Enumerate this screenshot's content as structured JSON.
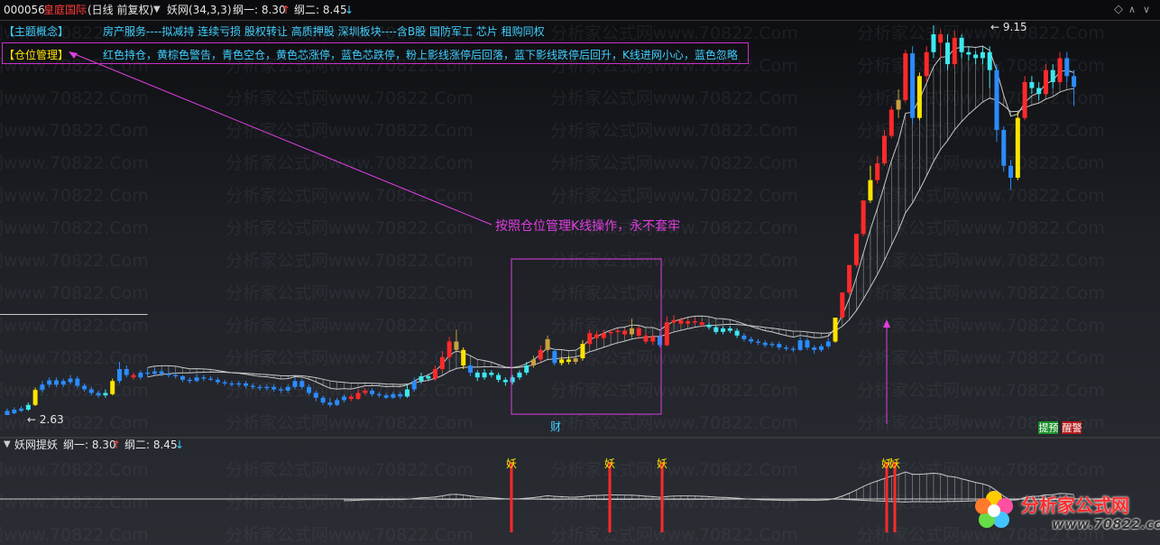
{
  "header": {
    "stock_code": "000056",
    "stock_name": "皇庭国际",
    "period": "(日线 前复权)",
    "indicator": "妖网(34,3,3)",
    "line1_label": "纲一: 8.30",
    "line1_arrow": "↑",
    "line2_label": "纲二: 8.45",
    "line2_arrow": "↓"
  },
  "info": {
    "theme_label": "【主题概念】",
    "theme_text": "房产服务----拟减持 连续亏损 股权转让 高质押股 深圳板块----含B股 国防军工 芯片 租购同权",
    "position_label": "【仓位管理】",
    "position_text": "红色持仓，黄棕色警告，青色空仓，黄色芯涨停，蓝色芯跌停，粉上影线涨停后回落，蓝下影线跌停后回升，K线进网小心，蓝色忽略"
  },
  "annotations": {
    "arrow_note": "按照仓位管理K线操作，永不套牢",
    "low_label": "2.63",
    "high_label": "9.15",
    "box_tag": "财",
    "tag_yu": "预",
    "tag_jing": "警",
    "tag_ti": "提",
    "tag_xing": "醒"
  },
  "sub_header": {
    "indicator": "妖网提妖",
    "line1_label": "纲一: 8.30",
    "line1_arrow": "↑",
    "line2_label": "纲二: 8.45",
    "line2_arrow": "↓"
  },
  "signal_char": "妖",
  "watermark": "分析家公式网www.70822.Com",
  "logo": {
    "name": "分析家公式网",
    "url": "www.70822.com"
  },
  "colors": {
    "red": "#ff2a2a",
    "yellow": "#ffe400",
    "brown": "#c8a040",
    "cyan": "#3de8f0",
    "blue": "#2a8cff",
    "white": "#ffffff",
    "band": "#c8c8c8",
    "magenta": "#e03ee0"
  },
  "chart_data": {
    "type": "candlestick",
    "y_range_approx": [
      2.4,
      9.3
    ],
    "candles": [
      {
        "o": 2.63,
        "c": 2.7,
        "h": 2.74,
        "l": 2.63,
        "col": "blue"
      },
      {
        "o": 2.66,
        "c": 2.72,
        "h": 2.76,
        "l": 2.64,
        "col": "blue"
      },
      {
        "o": 2.7,
        "c": 2.74,
        "h": 2.78,
        "l": 2.68,
        "col": "blue"
      },
      {
        "o": 2.72,
        "c": 2.8,
        "h": 2.84,
        "l": 2.7,
        "col": "cyan"
      },
      {
        "o": 2.8,
        "c": 3.05,
        "h": 3.09,
        "l": 2.78,
        "col": "yellow"
      },
      {
        "o": 3.05,
        "c": 3.14,
        "h": 3.2,
        "l": 3.01,
        "col": "blue"
      },
      {
        "o": 3.14,
        "c": 3.21,
        "h": 3.26,
        "l": 3.09,
        "col": "blue"
      },
      {
        "o": 3.21,
        "c": 3.14,
        "h": 3.26,
        "l": 3.1,
        "col": "blue"
      },
      {
        "o": 3.14,
        "c": 3.2,
        "h": 3.24,
        "l": 3.1,
        "col": "blue"
      },
      {
        "o": 3.18,
        "c": 3.24,
        "h": 3.3,
        "l": 3.14,
        "col": "blue"
      },
      {
        "o": 3.24,
        "c": 3.12,
        "h": 3.28,
        "l": 3.08,
        "col": "blue"
      },
      {
        "o": 3.12,
        "c": 3.06,
        "h": 3.16,
        "l": 3.02,
        "col": "blue"
      },
      {
        "o": 3.06,
        "c": 3.0,
        "h": 3.1,
        "l": 2.96,
        "col": "blue"
      },
      {
        "o": 3.0,
        "c": 2.96,
        "h": 3.04,
        "l": 2.92,
        "col": "blue"
      },
      {
        "o": 2.96,
        "c": 3.0,
        "h": 3.06,
        "l": 2.92,
        "col": "cyan"
      },
      {
        "o": 2.98,
        "c": 3.2,
        "h": 3.24,
        "l": 2.96,
        "col": "yellow"
      },
      {
        "o": 3.2,
        "c": 3.4,
        "h": 3.52,
        "l": 3.16,
        "col": "blue"
      },
      {
        "o": 3.4,
        "c": 3.3,
        "h": 3.46,
        "l": 3.26,
        "col": "blue"
      },
      {
        "o": 3.3,
        "c": 3.26,
        "h": 3.34,
        "l": 3.22,
        "col": "red"
      },
      {
        "o": 3.26,
        "c": 3.34,
        "h": 3.38,
        "l": 3.22,
        "col": "blue"
      },
      {
        "o": 3.34,
        "c": 3.32,
        "h": 3.4,
        "l": 3.28,
        "col": "blue"
      },
      {
        "o": 3.32,
        "c": 3.36,
        "h": 3.42,
        "l": 3.28,
        "col": "blue"
      },
      {
        "o": 3.36,
        "c": 3.32,
        "h": 3.4,
        "l": 3.28,
        "col": "blue"
      },
      {
        "o": 3.32,
        "c": 3.3,
        "h": 3.36,
        "l": 3.26,
        "col": "blue"
      },
      {
        "o": 3.3,
        "c": 3.28,
        "h": 3.34,
        "l": 3.24,
        "col": "blue"
      },
      {
        "o": 3.28,
        "c": 3.22,
        "h": 3.3,
        "l": 3.18,
        "col": "blue"
      },
      {
        "o": 3.22,
        "c": 3.2,
        "h": 3.26,
        "l": 3.16,
        "col": "blue"
      },
      {
        "o": 3.2,
        "c": 3.26,
        "h": 3.32,
        "l": 3.18,
        "col": "blue"
      },
      {
        "o": 3.26,
        "c": 3.24,
        "h": 3.3,
        "l": 3.2,
        "col": "blue"
      },
      {
        "o": 3.24,
        "c": 3.22,
        "h": 3.28,
        "l": 3.2,
        "col": "blue"
      },
      {
        "o": 3.22,
        "c": 3.18,
        "h": 3.26,
        "l": 3.14,
        "col": "blue"
      },
      {
        "o": 3.18,
        "c": 3.16,
        "h": 3.22,
        "l": 3.12,
        "col": "blue"
      },
      {
        "o": 3.16,
        "c": 3.14,
        "h": 3.2,
        "l": 3.1,
        "col": "blue"
      },
      {
        "o": 3.14,
        "c": 3.16,
        "h": 3.2,
        "l": 3.1,
        "col": "blue"
      },
      {
        "o": 3.16,
        "c": 3.12,
        "h": 3.2,
        "l": 3.08,
        "col": "blue"
      },
      {
        "o": 3.12,
        "c": 3.1,
        "h": 3.16,
        "l": 3.06,
        "col": "blue"
      },
      {
        "o": 3.1,
        "c": 3.08,
        "h": 3.14,
        "l": 3.04,
        "col": "blue"
      },
      {
        "o": 3.08,
        "c": 3.1,
        "h": 3.14,
        "l": 3.04,
        "col": "blue"
      },
      {
        "o": 3.1,
        "c": 3.06,
        "h": 3.14,
        "l": 3.02,
        "col": "blue"
      },
      {
        "o": 3.06,
        "c": 3.04,
        "h": 3.1,
        "l": 3.0,
        "col": "blue"
      },
      {
        "o": 3.04,
        "c": 3.1,
        "h": 3.14,
        "l": 3.0,
        "col": "blue"
      },
      {
        "o": 3.1,
        "c": 3.2,
        "h": 3.26,
        "l": 3.06,
        "col": "blue"
      },
      {
        "o": 3.2,
        "c": 3.1,
        "h": 3.24,
        "l": 3.06,
        "col": "blue"
      },
      {
        "o": 3.1,
        "c": 3.0,
        "h": 3.14,
        "l": 2.96,
        "col": "blue"
      },
      {
        "o": 3.0,
        "c": 2.92,
        "h": 3.04,
        "l": 2.86,
        "col": "blue"
      },
      {
        "o": 2.92,
        "c": 2.84,
        "h": 2.96,
        "l": 2.8,
        "col": "blue"
      },
      {
        "o": 2.84,
        "c": 2.8,
        "h": 2.92,
        "l": 2.76,
        "col": "blue"
      },
      {
        "o": 2.8,
        "c": 2.88,
        "h": 2.92,
        "l": 2.78,
        "col": "blue"
      },
      {
        "o": 2.88,
        "c": 2.94,
        "h": 2.98,
        "l": 2.84,
        "col": "blue"
      },
      {
        "o": 2.94,
        "c": 2.9,
        "h": 2.98,
        "l": 2.86,
        "col": "red"
      },
      {
        "o": 2.9,
        "c": 3.0,
        "h": 3.06,
        "l": 2.88,
        "col": "red"
      },
      {
        "o": 3.0,
        "c": 3.04,
        "h": 3.08,
        "l": 2.96,
        "col": "red"
      },
      {
        "o": 3.04,
        "c": 2.98,
        "h": 3.08,
        "l": 2.94,
        "col": "blue"
      },
      {
        "o": 2.98,
        "c": 2.96,
        "h": 3.02,
        "l": 2.92,
        "col": "blue"
      },
      {
        "o": 2.96,
        "c": 2.92,
        "h": 3.0,
        "l": 2.9,
        "col": "blue"
      },
      {
        "o": 2.92,
        "c": 2.98,
        "h": 3.02,
        "l": 2.9,
        "col": "blue"
      },
      {
        "o": 2.98,
        "c": 2.94,
        "h": 3.02,
        "l": 2.9,
        "col": "blue"
      },
      {
        "o": 2.94,
        "c": 3.06,
        "h": 3.14,
        "l": 2.92,
        "col": "cyan"
      },
      {
        "o": 3.06,
        "c": 3.2,
        "h": 3.26,
        "l": 3.02,
        "col": "blue"
      },
      {
        "o": 3.2,
        "c": 3.28,
        "h": 3.34,
        "l": 3.16,
        "col": "cyan"
      },
      {
        "o": 3.28,
        "c": 3.24,
        "h": 3.32,
        "l": 3.2,
        "col": "cyan"
      },
      {
        "o": 3.24,
        "c": 3.4,
        "h": 3.46,
        "l": 3.2,
        "col": "red"
      },
      {
        "o": 3.4,
        "c": 3.6,
        "h": 3.7,
        "l": 3.36,
        "col": "red"
      },
      {
        "o": 3.6,
        "c": 3.86,
        "h": 3.94,
        "l": 3.56,
        "col": "red"
      },
      {
        "o": 3.86,
        "c": 3.72,
        "h": 4.06,
        "l": 3.7,
        "col": "brown"
      },
      {
        "o": 3.72,
        "c": 3.46,
        "h": 3.76,
        "l": 3.4,
        "col": "yellow"
      },
      {
        "o": 3.46,
        "c": 3.34,
        "h": 3.5,
        "l": 3.28,
        "col": "blue"
      },
      {
        "o": 3.34,
        "c": 3.26,
        "h": 3.38,
        "l": 3.2,
        "col": "cyan"
      },
      {
        "o": 3.26,
        "c": 3.34,
        "h": 3.4,
        "l": 3.22,
        "col": "cyan"
      },
      {
        "o": 3.34,
        "c": 3.3,
        "h": 3.38,
        "l": 3.26,
        "col": "cyan"
      },
      {
        "o": 3.3,
        "c": 3.22,
        "h": 3.34,
        "l": 3.18,
        "col": "cyan"
      },
      {
        "o": 3.22,
        "c": 3.18,
        "h": 3.26,
        "l": 3.12,
        "col": "cyan"
      },
      {
        "o": 3.18,
        "c": 3.26,
        "h": 3.3,
        "l": 3.14,
        "col": "cyan"
      },
      {
        "o": 3.26,
        "c": 3.34,
        "h": 3.38,
        "l": 3.22,
        "col": "cyan"
      },
      {
        "o": 3.34,
        "c": 3.46,
        "h": 3.52,
        "l": 3.3,
        "col": "cyan"
      },
      {
        "o": 3.46,
        "c": 3.56,
        "h": 3.62,
        "l": 3.42,
        "col": "brown"
      },
      {
        "o": 3.56,
        "c": 3.72,
        "h": 3.8,
        "l": 3.52,
        "col": "red"
      },
      {
        "o": 3.72,
        "c": 3.9,
        "h": 3.96,
        "l": 3.68,
        "col": "brown"
      },
      {
        "o": 3.7,
        "c": 3.5,
        "h": 3.74,
        "l": 3.46,
        "col": "blue"
      },
      {
        "o": 3.5,
        "c": 3.56,
        "h": 3.6,
        "l": 3.46,
        "col": "yellow"
      },
      {
        "o": 3.56,
        "c": 3.52,
        "h": 3.62,
        "l": 3.48,
        "col": "yellow"
      },
      {
        "o": 3.52,
        "c": 3.58,
        "h": 3.62,
        "l": 3.48,
        "col": "brown"
      },
      {
        "o": 3.58,
        "c": 3.82,
        "h": 3.88,
        "l": 3.54,
        "col": "yellow"
      },
      {
        "o": 3.82,
        "c": 4.0,
        "h": 4.06,
        "l": 3.78,
        "col": "red"
      },
      {
        "o": 3.98,
        "c": 3.92,
        "h": 4.04,
        "l": 3.88,
        "col": "red"
      },
      {
        "o": 3.92,
        "c": 4.0,
        "h": 4.06,
        "l": 3.88,
        "col": "red"
      },
      {
        "o": 4.0,
        "c": 4.02,
        "h": 4.06,
        "l": 3.96,
        "col": "red"
      },
      {
        "o": 4.02,
        "c": 4.04,
        "h": 4.08,
        "l": 3.98,
        "col": "red"
      },
      {
        "o": 4.04,
        "c": 3.98,
        "h": 4.08,
        "l": 3.94,
        "col": "red"
      },
      {
        "o": 3.98,
        "c": 4.08,
        "h": 4.24,
        "l": 3.94,
        "col": "brown"
      },
      {
        "o": 4.08,
        "c": 3.96,
        "h": 4.12,
        "l": 3.9,
        "col": "red"
      },
      {
        "o": 3.96,
        "c": 3.86,
        "h": 4.0,
        "l": 3.82,
        "col": "red"
      },
      {
        "o": 3.86,
        "c": 3.94,
        "h": 3.98,
        "l": 3.8,
        "col": "red"
      },
      {
        "o": 3.94,
        "c": 3.8,
        "h": 3.98,
        "l": 3.76,
        "col": "blue"
      },
      {
        "o": 3.8,
        "c": 4.18,
        "h": 4.28,
        "l": 3.78,
        "col": "red"
      },
      {
        "o": 4.18,
        "c": 4.22,
        "h": 4.3,
        "l": 4.14,
        "col": "red"
      },
      {
        "o": 4.22,
        "c": 4.16,
        "h": 4.26,
        "l": 4.12,
        "col": "red"
      },
      {
        "o": 4.16,
        "c": 4.2,
        "h": 4.24,
        "l": 4.12,
        "col": "red"
      },
      {
        "o": 4.2,
        "c": 4.18,
        "h": 4.26,
        "l": 4.14,
        "col": "red"
      },
      {
        "o": 4.18,
        "c": 4.14,
        "h": 4.22,
        "l": 4.1,
        "col": "red"
      },
      {
        "o": 4.14,
        "c": 4.1,
        "h": 4.18,
        "l": 4.06,
        "col": "cyan"
      },
      {
        "o": 4.1,
        "c": 4.02,
        "h": 4.14,
        "l": 3.98,
        "col": "cyan"
      },
      {
        "o": 4.02,
        "c": 4.08,
        "h": 4.12,
        "l": 3.98,
        "col": "cyan"
      },
      {
        "o": 4.08,
        "c": 4.04,
        "h": 4.12,
        "l": 4.0,
        "col": "cyan"
      },
      {
        "o": 4.04,
        "c": 3.96,
        "h": 4.08,
        "l": 3.92,
        "col": "cyan"
      },
      {
        "o": 3.96,
        "c": 3.9,
        "h": 4.0,
        "l": 3.86,
        "col": "blue"
      },
      {
        "o": 3.9,
        "c": 3.86,
        "h": 3.94,
        "l": 3.82,
        "col": "blue"
      },
      {
        "o": 3.86,
        "c": 3.84,
        "h": 3.9,
        "l": 3.8,
        "col": "blue"
      },
      {
        "o": 3.84,
        "c": 3.8,
        "h": 3.88,
        "l": 3.76,
        "col": "blue"
      },
      {
        "o": 3.8,
        "c": 3.82,
        "h": 3.86,
        "l": 3.76,
        "col": "blue"
      },
      {
        "o": 3.82,
        "c": 3.76,
        "h": 3.86,
        "l": 3.72,
        "col": "blue"
      },
      {
        "o": 3.76,
        "c": 3.74,
        "h": 3.8,
        "l": 3.7,
        "col": "blue"
      },
      {
        "o": 3.74,
        "c": 3.72,
        "h": 3.78,
        "l": 3.68,
        "col": "blue"
      },
      {
        "o": 3.72,
        "c": 3.88,
        "h": 3.94,
        "l": 3.7,
        "col": "blue"
      },
      {
        "o": 3.88,
        "c": 3.76,
        "h": 3.92,
        "l": 3.72,
        "col": "blue"
      },
      {
        "o": 3.76,
        "c": 3.72,
        "h": 3.8,
        "l": 3.66,
        "col": "blue"
      },
      {
        "o": 3.72,
        "c": 3.78,
        "h": 3.82,
        "l": 3.68,
        "col": "blue"
      },
      {
        "o": 3.78,
        "c": 3.86,
        "h": 3.92,
        "l": 3.74,
        "col": "blue"
      },
      {
        "o": 3.86,
        "c": 4.26,
        "h": 4.26,
        "l": 3.84,
        "col": "yellow"
      },
      {
        "o": 4.26,
        "c": 4.68,
        "h": 4.68,
        "l": 4.24,
        "col": "red"
      },
      {
        "o": 4.68,
        "c": 5.14,
        "h": 5.14,
        "l": 4.64,
        "col": "red"
      },
      {
        "o": 5.14,
        "c": 5.66,
        "h": 5.66,
        "l": 5.1,
        "col": "red"
      },
      {
        "o": 5.66,
        "c": 6.22,
        "h": 6.22,
        "l": 5.62,
        "col": "red"
      },
      {
        "o": 6.22,
        "c": 6.56,
        "h": 6.8,
        "l": 6.18,
        "col": "yellow"
      },
      {
        "o": 6.56,
        "c": 6.84,
        "h": 6.96,
        "l": 6.5,
        "col": "red"
      },
      {
        "o": 6.84,
        "c": 7.3,
        "h": 7.4,
        "l": 6.8,
        "col": "red"
      },
      {
        "o": 7.3,
        "c": 7.74,
        "h": 7.8,
        "l": 7.26,
        "col": "red"
      },
      {
        "o": 7.74,
        "c": 7.9,
        "h": 8.08,
        "l": 7.6,
        "col": "brown"
      },
      {
        "o": 7.9,
        "c": 8.68,
        "h": 8.74,
        "l": 7.86,
        "col": "red"
      },
      {
        "o": 8.68,
        "c": 7.6,
        "h": 8.8,
        "l": 7.5,
        "col": "blue"
      },
      {
        "o": 7.6,
        "c": 8.3,
        "h": 8.36,
        "l": 7.56,
        "col": "yellow"
      },
      {
        "o": 8.3,
        "c": 8.7,
        "h": 8.8,
        "l": 8.2,
        "col": "red"
      },
      {
        "o": 8.7,
        "c": 9.0,
        "h": 9.15,
        "l": 8.6,
        "col": "cyan"
      },
      {
        "o": 9.0,
        "c": 8.86,
        "h": 9.08,
        "l": 8.6,
        "col": "red"
      },
      {
        "o": 8.86,
        "c": 8.5,
        "h": 9.0,
        "l": 8.4,
        "col": "cyan"
      },
      {
        "o": 8.5,
        "c": 8.94,
        "h": 9.06,
        "l": 8.46,
        "col": "red"
      },
      {
        "o": 8.94,
        "c": 8.7,
        "h": 9.0,
        "l": 8.6,
        "col": "cyan"
      },
      {
        "o": 8.7,
        "c": 8.66,
        "h": 8.8,
        "l": 8.56,
        "col": "cyan"
      },
      {
        "o": 8.66,
        "c": 8.6,
        "h": 8.72,
        "l": 8.5,
        "col": "cyan"
      },
      {
        "o": 8.6,
        "c": 8.7,
        "h": 8.8,
        "l": 8.5,
        "col": "cyan"
      },
      {
        "o": 8.7,
        "c": 8.4,
        "h": 8.8,
        "l": 8.1,
        "col": "cyan"
      },
      {
        "o": 8.4,
        "c": 7.4,
        "h": 8.5,
        "l": 7.2,
        "col": "blue"
      },
      {
        "o": 7.4,
        "c": 6.8,
        "h": 7.46,
        "l": 6.7,
        "col": "blue"
      },
      {
        "o": 6.8,
        "c": 6.6,
        "h": 6.9,
        "l": 6.4,
        "col": "blue"
      },
      {
        "o": 6.6,
        "c": 7.6,
        "h": 7.7,
        "l": 6.56,
        "col": "yellow"
      },
      {
        "o": 7.6,
        "c": 8.2,
        "h": 8.3,
        "l": 7.56,
        "col": "red"
      },
      {
        "o": 8.2,
        "c": 8.1,
        "h": 8.3,
        "l": 8.0,
        "col": "cyan"
      },
      {
        "o": 8.1,
        "c": 8.0,
        "h": 8.2,
        "l": 7.9,
        "col": "cyan"
      },
      {
        "o": 8.0,
        "c": 8.4,
        "h": 8.5,
        "l": 7.96,
        "col": "red"
      },
      {
        "o": 8.4,
        "c": 8.2,
        "h": 8.5,
        "l": 8.1,
        "col": "cyan"
      },
      {
        "o": 8.2,
        "c": 8.6,
        "h": 8.7,
        "l": 8.16,
        "col": "red"
      },
      {
        "o": 8.6,
        "c": 8.3,
        "h": 8.7,
        "l": 8.2,
        "col": "blue"
      },
      {
        "o": 8.3,
        "c": 8.12,
        "h": 8.4,
        "l": 7.8,
        "col": "blue"
      }
    ]
  }
}
